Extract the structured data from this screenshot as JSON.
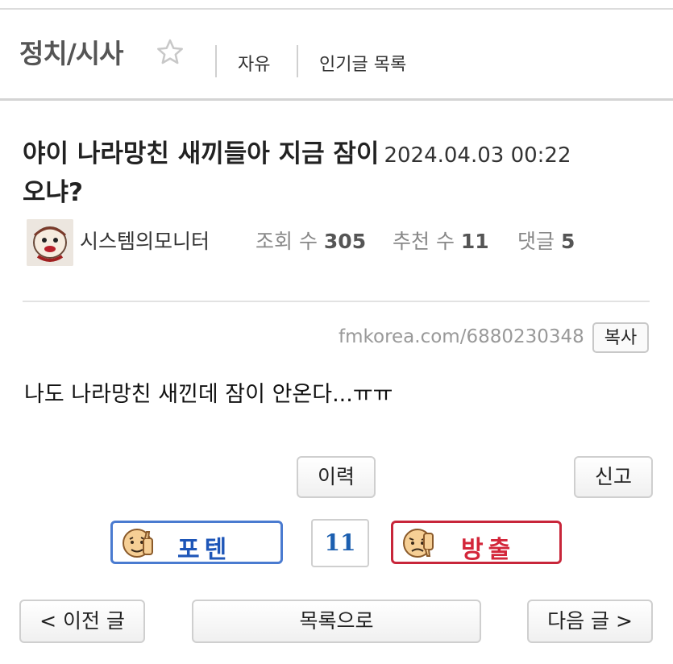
{
  "header": {
    "board_title": "정치/시사",
    "links": [
      "자유",
      "인기글 목록"
    ]
  },
  "post": {
    "title": "야이 나라망친 새끼들아 지금 잠이 오냐?",
    "title_line1": "야이 나라망친 새끼들아 지금 잠이",
    "title_line2": "오냐?",
    "date": "2024.04.03 00:22",
    "author": "시스템의모니터",
    "views_label": "조회 수",
    "views": "305",
    "recommend_label": "추천 수",
    "recommend": "11",
    "comments_label": "댓글",
    "comments": "5",
    "url": "fmkorea.com/6880230348",
    "copy_label": "복사",
    "body": "나도 나라망친 새낀데 잠이 안온다...ㅠㅠ"
  },
  "actions": {
    "history_label": "이력",
    "report_label": "신고",
    "upvote_label": "포텐",
    "vote_count": "11",
    "downvote_label": "방출"
  },
  "nav": {
    "prev_label": "< 이전 글",
    "list_label": "목록으로",
    "next_label": "다음 글 >"
  },
  "colors": {
    "upvote": "#4a7bd0",
    "downvote": "#c8263a",
    "count": "#1c5fb0"
  },
  "icons": {
    "favorite": "star-outline-icon",
    "upvote": "thumbs-up-face-icon",
    "downvote": "thumbs-down-face-icon"
  }
}
